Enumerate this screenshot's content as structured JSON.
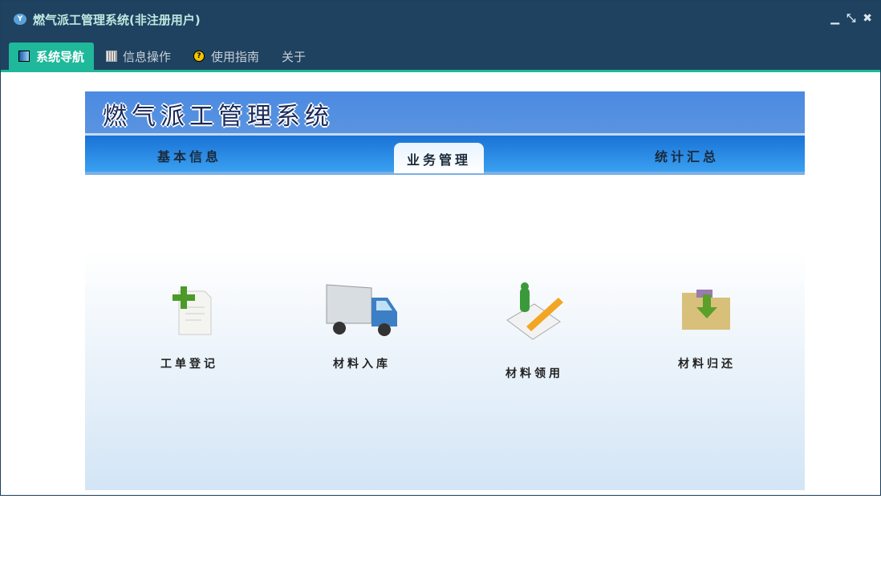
{
  "window": {
    "title": "燃气派工管理系统(非注册用户)",
    "controls": [
      "minimize",
      "restore",
      "close"
    ]
  },
  "menu": [
    {
      "label": "系统导航",
      "icon": "monitor-icon",
      "active": true
    },
    {
      "label": "信息操作",
      "icon": "grid-icon"
    },
    {
      "label": "使用指南",
      "icon": "help-icon"
    },
    {
      "label": "关于"
    }
  ],
  "banner": {
    "title": "燃气派工管理系统"
  },
  "nav": [
    {
      "label": "基本信息"
    },
    {
      "label": "业务管理",
      "active": true
    },
    {
      "label": "统计汇总"
    }
  ],
  "tiles": [
    {
      "label": "工单登记",
      "icon": "add-document-icon"
    },
    {
      "label": "材料入库",
      "icon": "truck-icon"
    },
    {
      "label": "材料领用",
      "icon": "edit-pencil-icon"
    },
    {
      "label": "材料归还",
      "icon": "folder-download-icon"
    }
  ]
}
